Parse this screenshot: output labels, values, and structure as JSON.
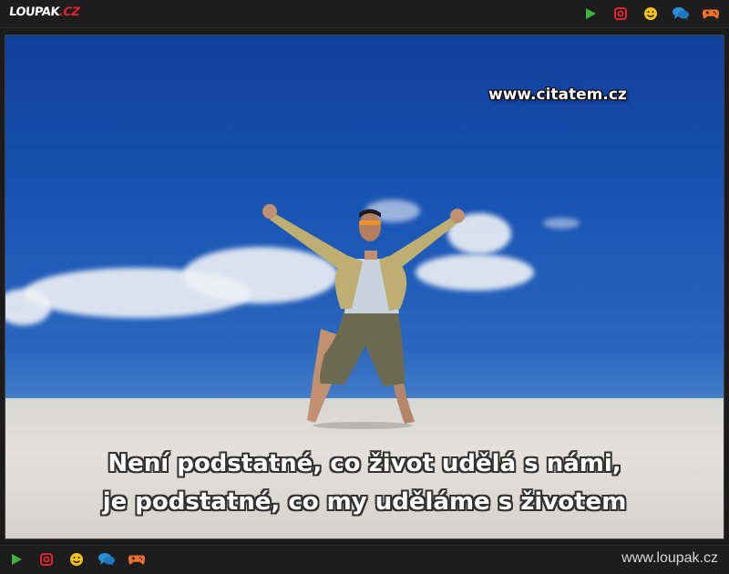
{
  "header": {
    "logo_text": "LOUPAK",
    "logo_suffix": ".CZ",
    "icons": [
      "play-icon",
      "instagram-icon",
      "smiley-icon",
      "chat-icon",
      "gamepad-icon"
    ]
  },
  "image": {
    "watermark": "www.citatem.cz",
    "quote_line1": "Není podstatné, co život udělá s námi,",
    "quote_line2": "je podstatné, co my uděláme s životem"
  },
  "footer": {
    "site": "www.loupak.cz",
    "icons": [
      "play-icon",
      "instagram-icon",
      "smiley-icon",
      "chat-icon",
      "gamepad-icon"
    ]
  },
  "colors": {
    "play": "#3fb43c",
    "instagram": "#e0242c",
    "smiley": "#f3c316",
    "chat": "#2b8fd6",
    "gamepad": "#f0712a"
  }
}
